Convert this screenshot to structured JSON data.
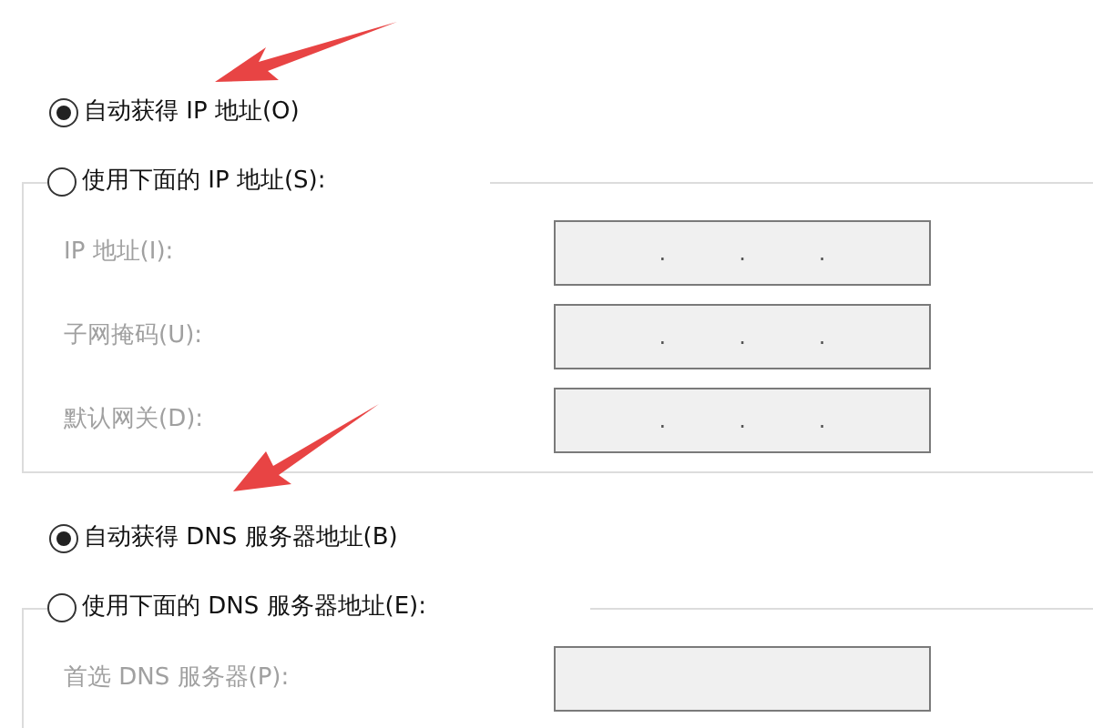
{
  "ip": {
    "options": [
      {
        "label": "自动获得 IP 地址(O)",
        "selected": true
      },
      {
        "label": "使用下面的 IP 地址(S):",
        "selected": false
      }
    ],
    "fields": [
      {
        "label": "IP 地址(I):",
        "disabled": true,
        "separators": [
          ".",
          ".",
          "."
        ]
      },
      {
        "label": "子网掩码(U):",
        "disabled": true,
        "separators": [
          ".",
          ".",
          "."
        ]
      },
      {
        "label": "默认网关(D):",
        "disabled": true,
        "separators": [
          ".",
          ".",
          "."
        ]
      }
    ]
  },
  "dns": {
    "options": [
      {
        "label": "自动获得 DNS 服务器地址(B)",
        "selected": true
      },
      {
        "label": "使用下面的 DNS 服务器地址(E):",
        "selected": false
      }
    ],
    "fields": [
      {
        "label": "首选 DNS 服务器(P):",
        "disabled": true
      }
    ]
  }
}
